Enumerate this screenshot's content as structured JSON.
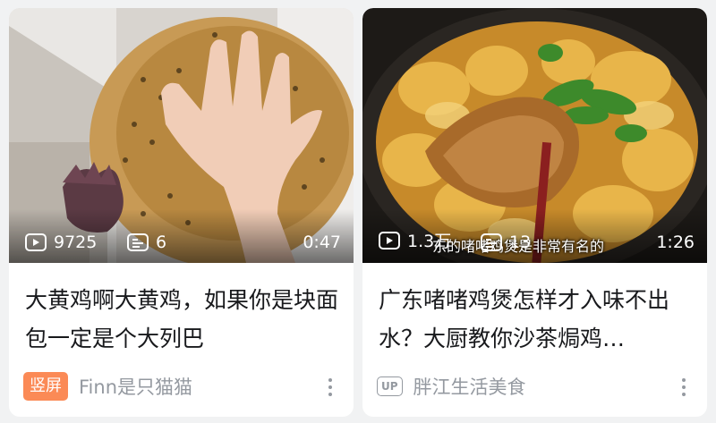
{
  "cards": [
    {
      "views": "9725",
      "danmaku": "6",
      "duration": "0:47",
      "title": "大黄鸡啊大黄鸡，如果你是块面包一定是个大列巴",
      "badge": "竖屏",
      "author": "Finn是只猫猫"
    },
    {
      "views": "1.3万",
      "danmaku": "13",
      "duration": "1:26",
      "overlay_caption": "东的啫啫鸡煲是非常有名的",
      "title": "广东啫啫鸡煲怎样才入味不出水？大厨教你沙茶焗鸡…",
      "up_label": "UP",
      "author": "胖江生活美食"
    }
  ],
  "icons": {
    "views": "play-count-icon",
    "danmaku": "danmaku-icon",
    "more": "more-vertical-icon"
  },
  "colors": {
    "badge": "#fb8a56",
    "muted": "#9499a0",
    "title": "#18191c"
  }
}
